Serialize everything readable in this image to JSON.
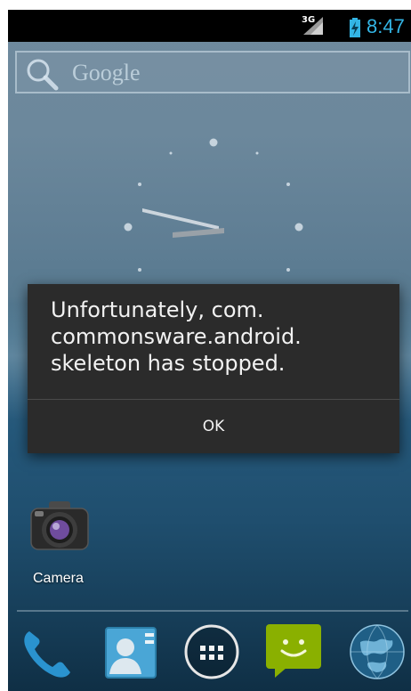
{
  "status_bar": {
    "network_label": "3G",
    "time": "8:47"
  },
  "search_widget": {
    "label": "Google"
  },
  "dialog": {
    "message": "Unfortunately, com.\ncommonsware.android.\nskeleton has stopped.",
    "ok_label": "OK"
  },
  "home_shortcuts": [
    {
      "label": "Camera",
      "icon": "camera-icon"
    }
  ],
  "dock": [
    {
      "icon": "phone-icon"
    },
    {
      "icon": "contacts-icon"
    },
    {
      "icon": "app-drawer-icon"
    },
    {
      "icon": "messaging-icon"
    },
    {
      "icon": "browser-globe-icon"
    }
  ],
  "colors": {
    "clock_text": "#33b5e5",
    "dialog_background": "#2b2b2b",
    "messaging_green": "#8ab000"
  }
}
